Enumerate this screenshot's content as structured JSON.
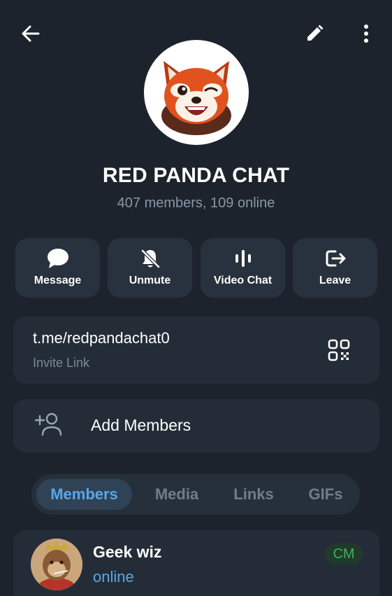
{
  "colors": {
    "background": "#1c232c",
    "card": "#242d37",
    "button": "#28323e",
    "accent": "#5aa6e8",
    "muted": "#8a97a6",
    "badge_green": "#3cb355"
  },
  "header": {
    "back_icon": "arrow-left-icon",
    "edit_icon": "pencil-icon",
    "more_icon": "vertical-dots-icon"
  },
  "group": {
    "avatar_icon": "red-panda-icon",
    "title": "RED PANDA CHAT",
    "subtitle": "407 members, 109 online"
  },
  "actions": [
    {
      "label": "Message",
      "icon": "chat-bubble-icon"
    },
    {
      "label": "Unmute",
      "icon": "bell-off-icon"
    },
    {
      "label": "Video Chat",
      "icon": "audio-bars-icon"
    },
    {
      "label": "Leave",
      "icon": "exit-icon"
    }
  ],
  "invite": {
    "link": "t.me/redpandachat0",
    "label": "Invite Link",
    "qr_icon": "qr-code-icon"
  },
  "add_members": {
    "label": "Add Members",
    "icon": "add-person-icon"
  },
  "tabs": [
    {
      "label": "Members",
      "active": true
    },
    {
      "label": "Media",
      "active": false
    },
    {
      "label": "Links",
      "active": false
    },
    {
      "label": "GIFs",
      "active": false
    }
  ],
  "members": [
    {
      "name": "Geek wiz",
      "status": "online",
      "badge": "CM"
    }
  ]
}
